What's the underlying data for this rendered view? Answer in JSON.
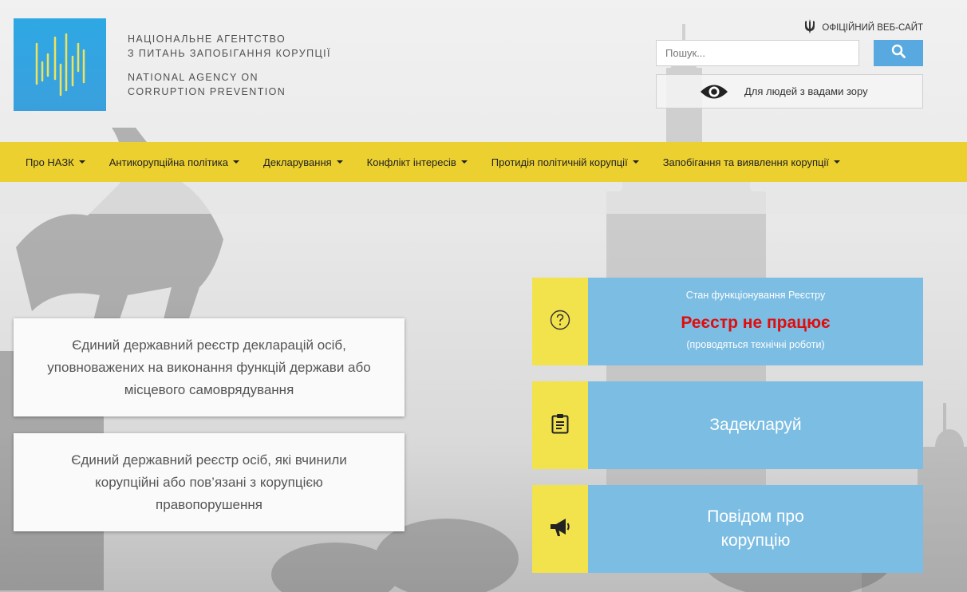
{
  "header": {
    "agency_ua_line1": "НАЦІОНАЛЬНЕ АГЕНТСТВО",
    "agency_ua_line2": "З ПИТАНЬ ЗАПОБІГАННЯ КОРУПЦІЇ",
    "agency_en_line1": "NATIONAL AGENCY ON",
    "agency_en_line2": "CORRUPTION PREVENTION",
    "official_site": "ОФІЦІЙНИЙ ВЕБ-САЙТ",
    "search_placeholder": "Пошук...",
    "vision_label": "Для людей з вадами зору",
    "logo_color": "#3aa0dd"
  },
  "nav": {
    "items": [
      {
        "label": "Про НАЗК",
        "icon": "caret-down"
      },
      {
        "label": "Антикорупційна політика",
        "icon": "caret-down"
      },
      {
        "label": "Декларування",
        "icon": "caret-down"
      },
      {
        "label": "Конфлікт інтересів",
        "icon": "caret-down"
      },
      {
        "label": "Протидія політичній корупції",
        "icon": "caret-down"
      },
      {
        "label": "Запобігання та виявлення корупції",
        "icon": "caret-down"
      }
    ],
    "bg_color": "#ecd02f"
  },
  "registries": [
    {
      "title": "Єдиний державний реєстр декларацій осіб, уповноважених на виконання функцій держави або місцевого самоврядування"
    },
    {
      "title": "Єдиний державний реєстр осіб, які вчинили корупційні або пов’язані з корупцією правопорушення"
    }
  ],
  "tiles": {
    "status": {
      "icon": "question-circle-icon",
      "caption": "Стан функціонування Реєстру",
      "value": "Реєстр не працює",
      "note": "(проводяться технічні роботи)",
      "value_color": "#e00d0d"
    },
    "declare": {
      "icon": "clipboard-icon",
      "label": "Задекларуй"
    },
    "report": {
      "icon": "megaphone-icon",
      "label_line1": "Повідом про",
      "label_line2": "корупцію"
    },
    "icon_bg": "#f2e24c",
    "body_bg": "#7cbde3"
  }
}
